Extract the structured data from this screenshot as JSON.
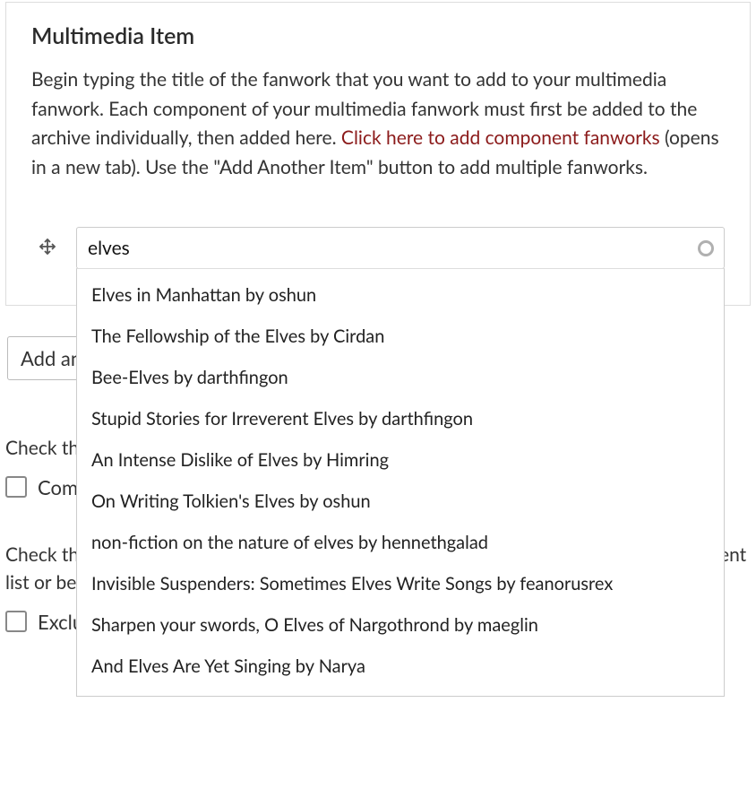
{
  "section": {
    "title": "Multimedia Item",
    "desc_part1": "Begin typing the title of the fanwork that you want to add to your multimedia fanwork. Each component of your multimedia fanwork must first be added to the archive individually, then added here. ",
    "link_text": "Click here to add component fanworks",
    "desc_part2": " (opens in a new tab). Use the \"Add Another Item\" button to add multiple fanworks."
  },
  "input": {
    "value": "elves"
  },
  "dropdown": {
    "items": [
      "Elves in Manhattan by oshun",
      "The Fellowship of the Elves by Cirdan",
      "Bee-Elves by darthfingon",
      "Stupid Stories for Irreverent Elves by darthfingon",
      "An Intense Dislike of Elves by Himring",
      "On Writing Tolkien's Elves by oshun",
      "non-fiction on the nature of elves by hennethgalad",
      "Invisible Suspenders: Sometimes Elves Write Songs by feanorusrex",
      "Sharpen your swords, O Elves of Nargothrond by maeglin",
      "And Elves Are Yet Singing by Narya"
    ]
  },
  "buttons": {
    "add_another": "Add another item"
  },
  "completion": {
    "helper": "Check the box if this fanwork is complete.",
    "label": "Completed"
  },
  "exclude": {
    "helper": "Check this box if you do NOT want your fanwork to show on the front page's Most Recent list or be bumped to the top when adding older fanworks.",
    "label": "Exclude from Most Recent"
  }
}
